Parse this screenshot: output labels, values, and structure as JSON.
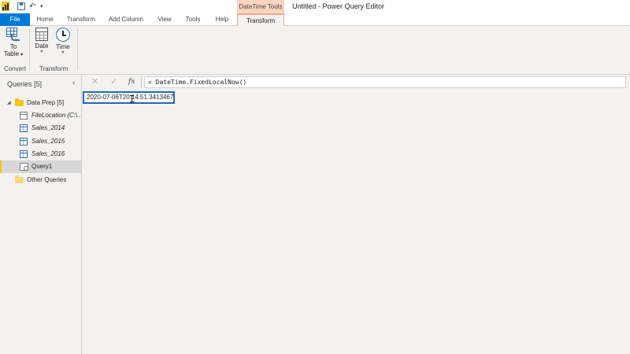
{
  "window": {
    "title": "Untitled - Power Query Editor",
    "context_tab_group": "DateTime Tools"
  },
  "quick_access": {
    "icons": [
      "powerbi-logo",
      "save-icon",
      "undo-icon",
      "customize-icon"
    ]
  },
  "tabs": [
    {
      "label": "File"
    },
    {
      "label": "Home"
    },
    {
      "label": "Transform"
    },
    {
      "label": "Add Column"
    },
    {
      "label": "View"
    },
    {
      "label": "Tools"
    },
    {
      "label": "Help"
    },
    {
      "label": "Transform"
    }
  ],
  "ribbon": {
    "to_table": {
      "label1": "To",
      "label2": "Table"
    },
    "date": {
      "label": "Date"
    },
    "time": {
      "label": "Time"
    },
    "groups": {
      "convert": "Convert",
      "transform": "Transform"
    }
  },
  "queries": {
    "header": "Queries [5]",
    "items": [
      {
        "label": "Data Prep [5]",
        "type": "folder"
      },
      {
        "label": "FileLocation (C:\\...",
        "type": "parameter"
      },
      {
        "label": "Sales_2014",
        "type": "table"
      },
      {
        "label": "Sales_2015",
        "type": "table"
      },
      {
        "label": "Sales_2016",
        "type": "table"
      },
      {
        "label": "Query1",
        "type": "query",
        "selected": true
      },
      {
        "label": "Other Queries",
        "type": "folder"
      }
    ]
  },
  "formula_bar": {
    "cancel_icon": "✕",
    "commit_icon": "✓",
    "fx_label": "fx",
    "formula": "= DateTime.FixedLocalNow()"
  },
  "result": {
    "value": "2020-07-06T20:14:51.3413467"
  },
  "colors": {
    "accent": "#0078d4",
    "result_border": "#2168b6",
    "context_tab": "#fbd5c0",
    "folder": "#f2c811"
  }
}
